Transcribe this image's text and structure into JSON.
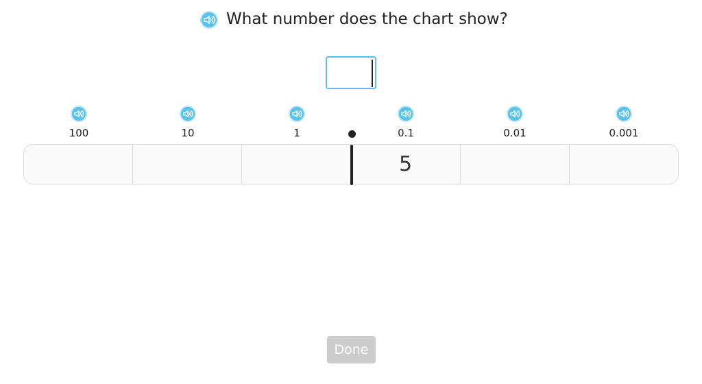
{
  "question": {
    "text": "What number does the chart show?",
    "speaker_icon": "speaker-icon"
  },
  "answer": {
    "value": "",
    "placeholder": ""
  },
  "place_values": [
    {
      "label": "100",
      "digit": ""
    },
    {
      "label": "10",
      "digit": ""
    },
    {
      "label": "1",
      "digit": ""
    },
    {
      "label": "0.1",
      "digit": "5"
    },
    {
      "label": "0.01",
      "digit": ""
    },
    {
      "label": "0.001",
      "digit": ""
    }
  ],
  "done": {
    "label": "Done"
  },
  "colors": {
    "accent": "#5bc2e7",
    "done_disabled": "#cccccc",
    "chart_border": "#dddddd"
  }
}
